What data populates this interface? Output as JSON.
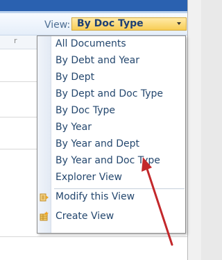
{
  "toolbar": {
    "view_label": "View:",
    "view_selected": "By Doc Type"
  },
  "left_column": {
    "header_fragment": "r"
  },
  "menu": {
    "items": [
      {
        "label": "All Documents"
      },
      {
        "label": "By Debt and Year"
      },
      {
        "label": "By Dept"
      },
      {
        "label": "By Dept and Doc Type"
      },
      {
        "label": "By Doc Type"
      },
      {
        "label": "By Year"
      },
      {
        "label": "By Year and Dept"
      },
      {
        "label": "By Year and Doc Type"
      },
      {
        "label": "Explorer View"
      }
    ],
    "actions": [
      {
        "label": "Modify this View",
        "icon": "modify-view-icon"
      },
      {
        "label": "Create View",
        "icon": "create-view-icon"
      }
    ]
  },
  "colors": {
    "accent": "#2a61b0",
    "select_bg": "#f7cd55",
    "menu_text": "#24476e",
    "arrow": "#c3282b"
  }
}
